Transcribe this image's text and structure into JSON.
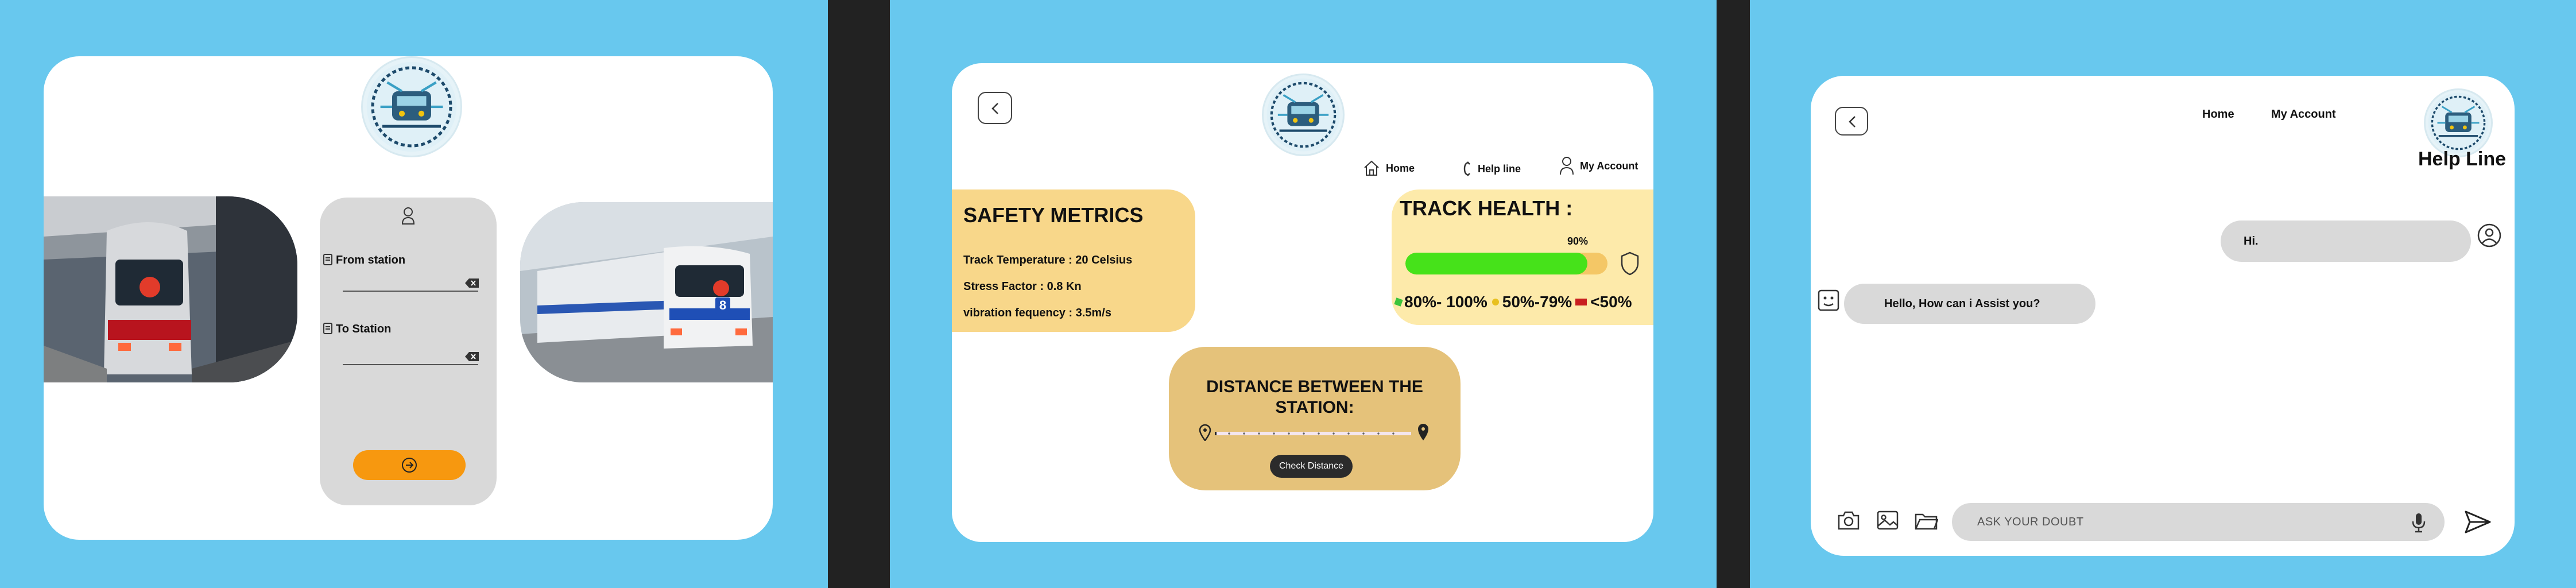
{
  "screen1": {
    "from_station_label": "From station",
    "to_station_label": "To Station",
    "photo_left_badge": "",
    "photo_right_badge": "8"
  },
  "screen2": {
    "nav": {
      "home": "Home",
      "helpline": "Help line",
      "account": "My Account"
    },
    "safety": {
      "title": "SAFETY METRICS",
      "rows": [
        "Track Temperature : 20 Celsius",
        "Stress Factor : 0.8 Kn",
        "vibration fequency : 3.5m/s"
      ]
    },
    "track": {
      "title": "TRACK HEALTH :",
      "percent_label": "90%",
      "percent_value": 0.9,
      "legend": [
        {
          "label": "80%- 100%",
          "color": "#3cc43c"
        },
        {
          "label": "50%-79%",
          "color": "#e8c020"
        },
        {
          "label": "<50%",
          "color": "#c81e1e"
        }
      ]
    },
    "distance": {
      "title": "DISTANCE BETWEEN THE STATION:",
      "button": "Check Distance"
    }
  },
  "screen3": {
    "nav": {
      "home": "Home",
      "account": "My Account"
    },
    "title": "Help Line",
    "messages": [
      {
        "from": "user",
        "text": "Hi."
      },
      {
        "from": "bot",
        "text": "Hello, How can i Assist you?"
      }
    ],
    "input_placeholder": "ASK YOUR DOUBT"
  },
  "colors": {
    "background": "#68c8ee",
    "divider": "#222222",
    "safety_card": "#f8d78a",
    "track_card": "#fdeaaa",
    "distance_card": "#e5c27a",
    "progress_fill": "#46e21a",
    "progress_track": "#f4c766",
    "submit_button": "#f7980f",
    "bubble": "#d9d9d9"
  },
  "icons": [
    "logo-emblem",
    "user-icon",
    "document-icon",
    "backspace-icon",
    "arrow-right-circle-icon",
    "back-arrow-icon",
    "home-icon",
    "phone-icon",
    "shield-icon",
    "location-pin-icon",
    "camera-icon",
    "image-icon",
    "folder-icon",
    "microphone-icon",
    "send-icon",
    "bot-face-icon"
  ]
}
